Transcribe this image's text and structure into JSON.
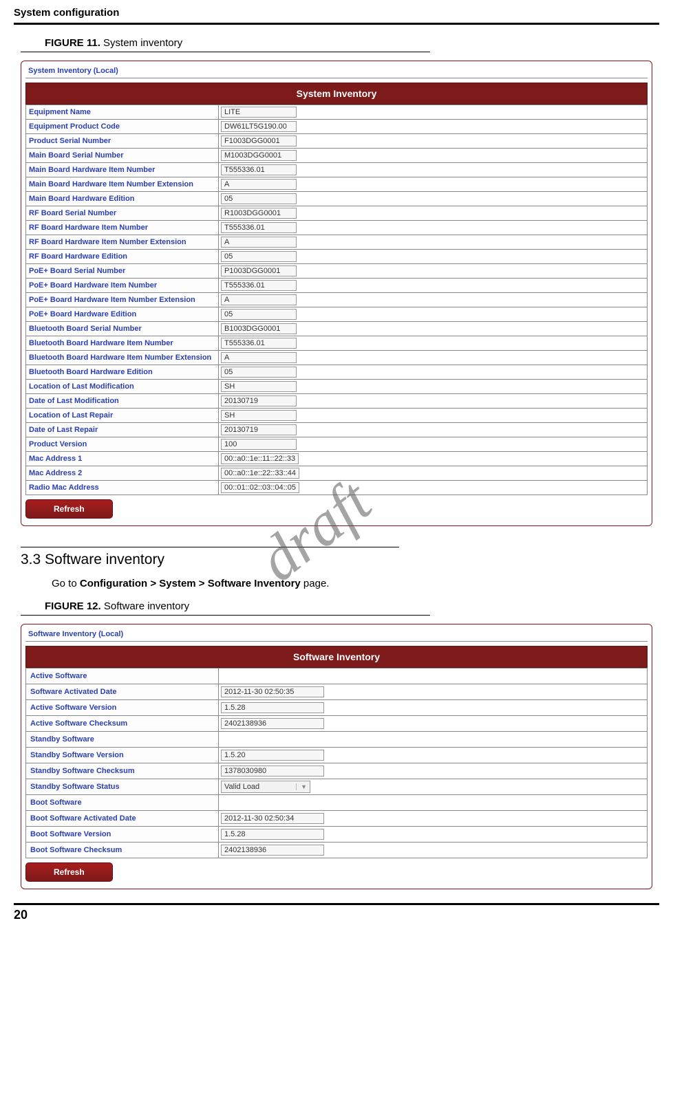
{
  "header": {
    "title": "System configuration"
  },
  "figure11": {
    "label": "FIGURE 11.",
    "caption": "System inventory"
  },
  "panel1": {
    "tab": "System Inventory (Local)",
    "title": "System Inventory",
    "rows": [
      {
        "label": "Equipment Name",
        "value": "LITE"
      },
      {
        "label": "Equipment Product Code",
        "value": "DW61LT5G190.00"
      },
      {
        "label": "Product Serial Number",
        "value": "F1003DGG0001"
      },
      {
        "label": "Main Board Serial Number",
        "value": "M1003DGG0001"
      },
      {
        "label": "Main Board Hardware Item Number",
        "value": "T555336.01"
      },
      {
        "label": "Main Board Hardware Item Number Extension",
        "value": "A"
      },
      {
        "label": "Main Board Hardware Edition",
        "value": "05"
      },
      {
        "label": "RF Board Serial Number",
        "value": "R1003DGG0001"
      },
      {
        "label": "RF Board Hardware Item Number",
        "value": "T555336.01"
      },
      {
        "label": "RF Board Hardware Item Number Extension",
        "value": "A"
      },
      {
        "label": "RF Board Hardware Edition",
        "value": "05"
      },
      {
        "label": "PoE+ Board Serial Number",
        "value": "P1003DGG0001"
      },
      {
        "label": "PoE+ Board Hardware Item Number",
        "value": "T555336.01"
      },
      {
        "label": "PoE+ Board Hardware Item Number Extension",
        "value": "A"
      },
      {
        "label": "PoE+ Board Hardware Edition",
        "value": "05"
      },
      {
        "label": "Bluetooth Board Serial Number",
        "value": "B1003DGG0001"
      },
      {
        "label": "Bluetooth Board Hardware Item Number",
        "value": "T555336.01"
      },
      {
        "label": "Bluetooth Board Hardware Item Number Extension",
        "value": "A"
      },
      {
        "label": "Bluetooth Board Hardware Edition",
        "value": "05"
      },
      {
        "label": "Location of Last Modification",
        "value": "SH"
      },
      {
        "label": "Date of Last Modification",
        "value": "20130719"
      },
      {
        "label": "Location of Last Repair",
        "value": "SH"
      },
      {
        "label": "Date of Last Repair",
        "value": "20130719"
      },
      {
        "label": "Product Version",
        "value": "100"
      },
      {
        "label": "Mac Address 1",
        "value": "00::a0::1e::11::22::33"
      },
      {
        "label": "Mac Address 2",
        "value": "00::a0::1e::22::33::44"
      },
      {
        "label": "Radio Mac Address",
        "value": "00::01::02::03::04::05"
      }
    ],
    "refresh": "Refresh"
  },
  "section33": {
    "heading": "3.3 Software inventory",
    "text_prefix": "Go to ",
    "text_bold": "Configuration > System > Software Inventory",
    "text_suffix": " page."
  },
  "figure12": {
    "label": "FIGURE 12.",
    "caption": "Software inventory"
  },
  "panel2": {
    "tab": "Software Inventory (Local)",
    "title": "Software Inventory",
    "rows": [
      {
        "label": "Active Software",
        "value": ""
      },
      {
        "label": "Software Activated Date",
        "value": "2012-11-30 02:50:35"
      },
      {
        "label": "Active Software Version",
        "value": "1.5.28"
      },
      {
        "label": "Active Software Checksum",
        "value": "2402138936"
      },
      {
        "label": "Standby Software",
        "value": ""
      },
      {
        "label": "Standby Software Version",
        "value": "1.5.20"
      },
      {
        "label": "Standby Software Checksum",
        "value": "1378030980"
      },
      {
        "label": "Standby Software Status",
        "value": "Valid Load",
        "select": true
      },
      {
        "label": "Boot Software",
        "value": ""
      },
      {
        "label": "Boot Software Activated Date",
        "value": "2012-11-30 02:50:34"
      },
      {
        "label": "Boot Software Version",
        "value": "1.5.28"
      },
      {
        "label": "Boot Software Checksum",
        "value": "2402138936"
      }
    ],
    "refresh": "Refresh"
  },
  "watermark": "draft",
  "page_number": "20"
}
